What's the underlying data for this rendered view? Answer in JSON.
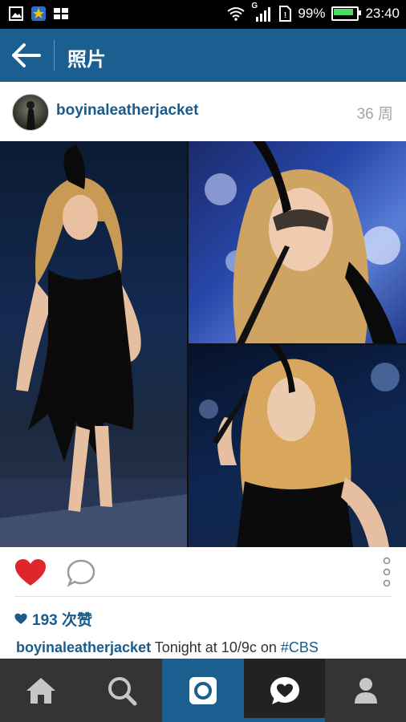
{
  "status_bar": {
    "network_type": "G",
    "battery": "99%",
    "battery_level": 0.99,
    "time": "23:40",
    "icons": [
      "image-icon",
      "notification-star-icon",
      "app-grid-icon",
      "wifi-icon",
      "signal-icon",
      "sim-icon",
      "battery-icon"
    ]
  },
  "topbar": {
    "back_icon": "arrow-left-icon",
    "title": "照片"
  },
  "post": {
    "username": "boyinaleatherjacket",
    "time_ago": "36 周",
    "likes_text": "193 次赞",
    "caption_user": "boyinaleatherjacket",
    "caption_text": " Tonight at 10/9c on ",
    "caption_hashtag": "#CBS"
  },
  "actions": {
    "like_icon": "heart-filled-icon",
    "comment_icon": "comment-bubble-icon",
    "more_icon": "more-vertical-icon"
  },
  "bottom_nav": {
    "items": [
      "home-icon",
      "search-icon",
      "camera-icon",
      "activity-heart-icon",
      "profile-icon"
    ],
    "active": "activity-heart-icon"
  },
  "colors": {
    "brand_blue": "#1a5f8f",
    "link_blue": "#185b8c",
    "like_red": "#e0262b",
    "nav_dark": "#343434"
  }
}
